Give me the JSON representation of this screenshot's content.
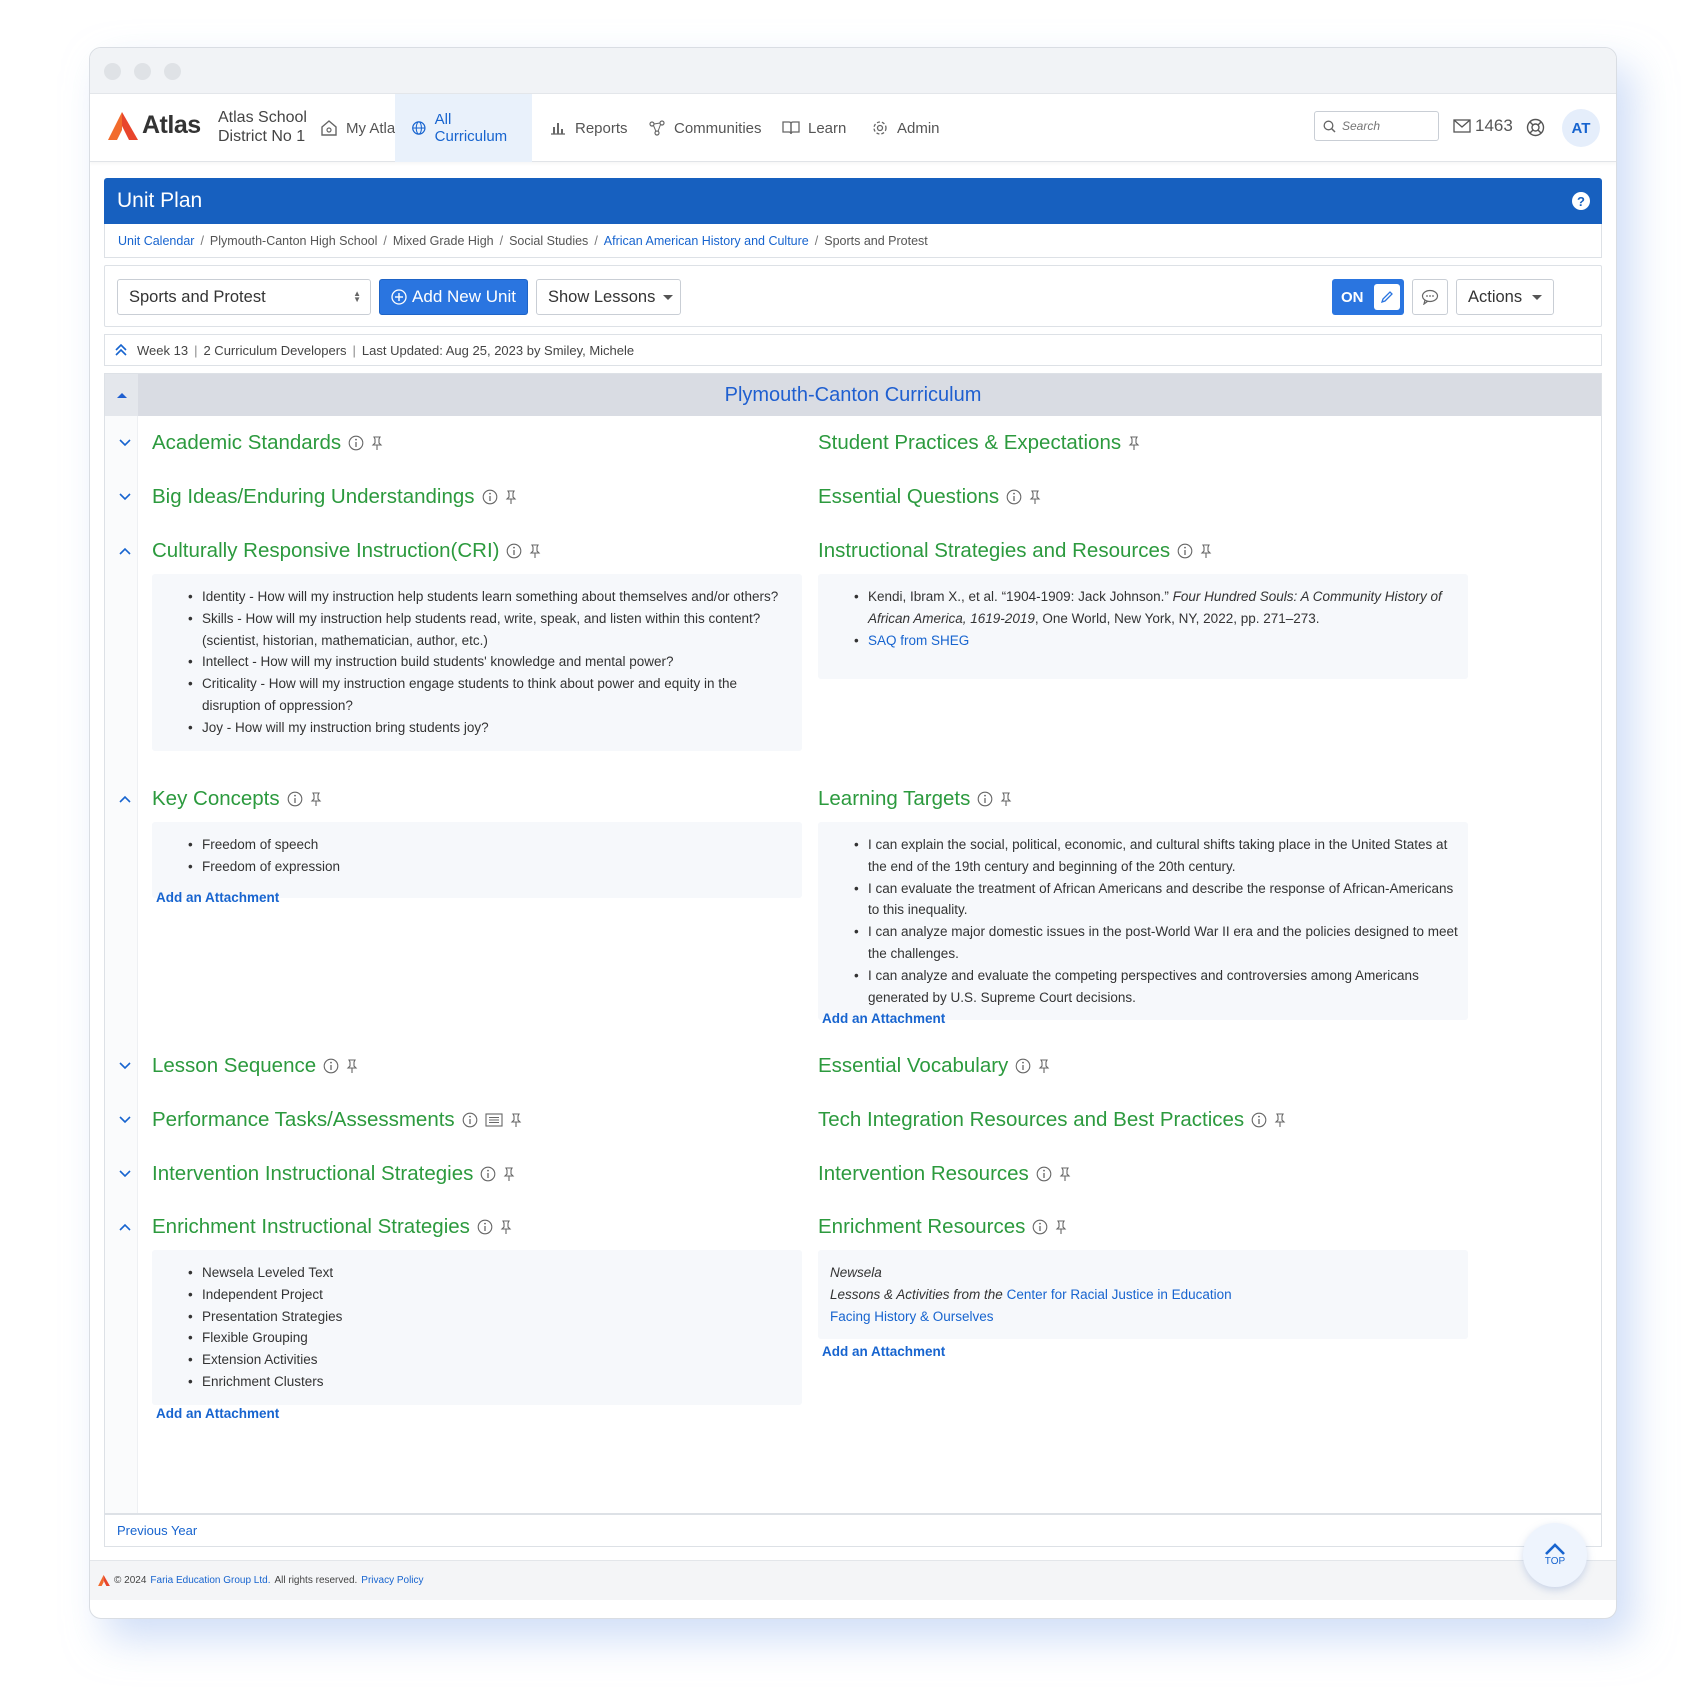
{
  "brand": {
    "name": "Atlas",
    "district": "Atlas School District No 1"
  },
  "nav": [
    {
      "label": "My Atlas",
      "icon": "home-icon"
    },
    {
      "label": "All Curriculum",
      "icon": "globe-icon",
      "active": true
    },
    {
      "label": "Reports",
      "icon": "bar-chart-icon"
    },
    {
      "label": "Communities",
      "icon": "network-icon"
    },
    {
      "label": "Learn",
      "icon": "book-icon"
    },
    {
      "label": "Admin",
      "icon": "gear-icon"
    }
  ],
  "search": {
    "placeholder": "Search"
  },
  "mail_count": "1463",
  "user_initials": "AT",
  "page": {
    "title": "Unit Plan"
  },
  "breadcrumbs": [
    {
      "label": "Unit Calendar",
      "link": true
    },
    {
      "label": "Plymouth-Canton High School",
      "link": false
    },
    {
      "label": "Mixed Grade High",
      "link": false
    },
    {
      "label": "Social Studies",
      "link": false
    },
    {
      "label": "African American History and Culture",
      "link": true
    },
    {
      "label": "Sports and Protest",
      "link": false
    }
  ],
  "toolbar": {
    "unit_select": "Sports and Protest",
    "add_unit": "Add New Unit",
    "show_lessons": "Show Lessons",
    "toggle": "ON",
    "actions": "Actions"
  },
  "meta": {
    "week": "Week 13",
    "developers": "2 Curriculum Developers",
    "updated": "Last Updated: Aug 25, 2023 by Smiley, Michele"
  },
  "curriculum_title": "Plymouth-Canton Curriculum",
  "attach_label": "Add an Attachment",
  "sections": {
    "academic_standards": "Academic Standards",
    "student_practices": "Student Practices & Expectations",
    "big_ideas": "Big Ideas/Enduring Understandings",
    "essential_questions": "Essential Questions",
    "cri": "Culturally Responsive Instruction(CRI)",
    "strategies": "Instructional Strategies and Resources",
    "key_concepts": "Key Concepts",
    "learning_targets": "Learning Targets",
    "lesson_sequence": "Lesson Sequence",
    "vocabulary": "Essential Vocabulary",
    "performance": "Performance Tasks/Assessments",
    "tech": "Tech Integration Resources and Best Practices",
    "intervention_strategies": "Intervention Instructional Strategies",
    "intervention_resources": "Intervention Resources",
    "enrichment_strategies": "Enrichment Instructional Strategies",
    "enrichment_resources": "Enrichment Resources"
  },
  "cri_items": [
    "Identity - How will my instruction help students learn something about themselves and/or others?",
    "Skills - How will my instruction help students read, write, speak, and listen within this content? (scientist, historian, mathematician, author, etc.)",
    "Intellect - How will my instruction build students' knowledge and mental power?",
    "Criticality - How will my instruction engage students to think about power and equity in the disruption of oppression?",
    "Joy - How will my instruction bring students joy?"
  ],
  "strategies_items": {
    "citation_plain": "Kendi, Ibram X., et al. “1904-1909: Jack Johnson.” ",
    "citation_italic": "Four Hundred Souls: A Community History of African America, 1619-2019",
    "citation_tail": ", One World, New York, NY, 2022, pp. 271–273.",
    "link": "SAQ from SHEG"
  },
  "key_concepts_items": [
    "Freedom of speech",
    "Freedom of expression"
  ],
  "learning_targets_items": [
    "I can explain the social, political, economic, and cultural shifts taking place in the United States at the end of the 19th century and beginning of the 20th century.",
    "I can evaluate the treatment of African Americans and describe the response of African-Americans to this inequality.",
    "I can analyze major domestic issues in the post-World War II era and the policies designed to meet the challenges.",
    "I can analyze and evaluate the competing perspectives and controversies among Americans generated by U.S. Supreme Court decisions."
  ],
  "enrichment_items": [
    "Newsela Leveled Text",
    "Independent Project",
    "Presentation Strategies",
    "Flexible Grouping",
    "Extension Activities",
    "Enrichment Clusters"
  ],
  "enrichment_resources": {
    "line1": "Newsela",
    "line2_prefix": "Lessons & Activities from the ",
    "line2_link": "Center for Racial Justice in Education",
    "line3_link": "Facing History & Ourselves"
  },
  "previous_year": "Previous Year",
  "top_label": "TOP",
  "footer": {
    "copyright": "© 2024",
    "company": "Faria Education Group Ltd.",
    "rights": "All rights reserved.",
    "privacy": "Privacy Policy"
  },
  "colors": {
    "primary": "#1760bf",
    "section_green": "#2c9a3e",
    "link_blue": "#1764cf",
    "band": "#d9dce3"
  }
}
